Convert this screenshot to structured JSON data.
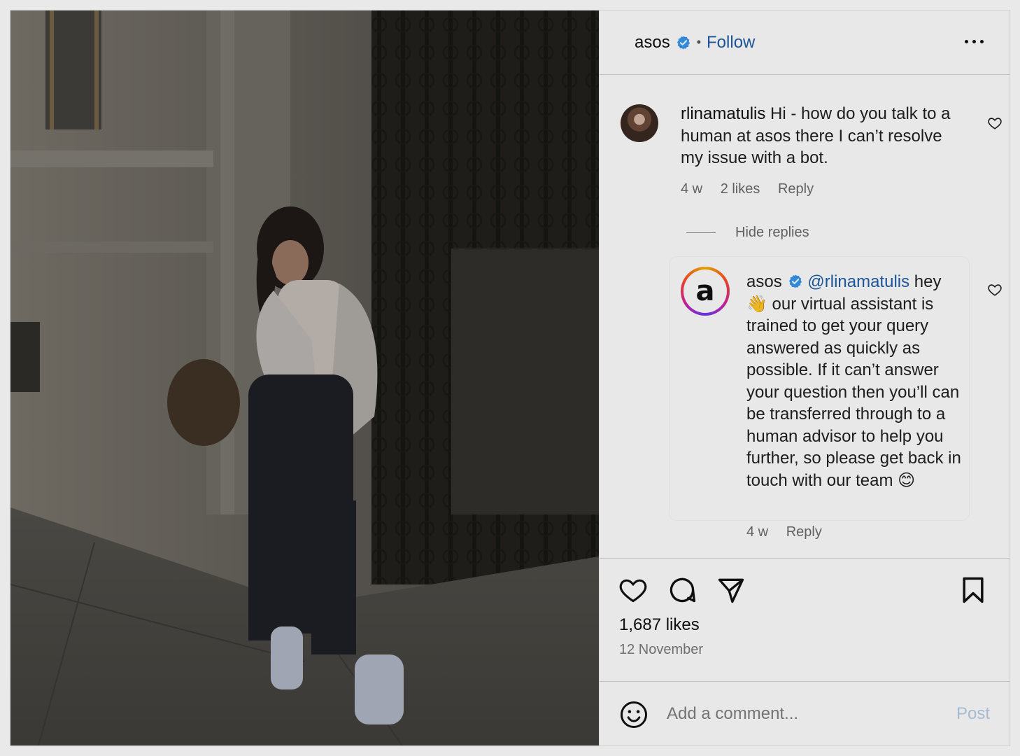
{
  "post": {
    "account": "asos",
    "follow_label": "Follow",
    "separator": "•"
  },
  "comment": {
    "username": "rlinamatulis",
    "text": " Hi - how do you talk to a human at asos there I can’t resolve my issue with a bot.",
    "time": "4 w",
    "likes": "2 likes",
    "reply_label": "Reply"
  },
  "hide_replies_label": "Hide replies",
  "reply": {
    "username": "asos",
    "avatar_letter": "a",
    "mention": "@rlinamatulis",
    "text_1": " hey 👋 our virtual assistant is trained to get your query answered as quickly as possible. If it can’t answer your question then you’ll can be transferred through to a human advisor to help you further, so please get back in touch with our team 😊",
    "time": "4 w",
    "reply_label": "Reply"
  },
  "stats": {
    "likes": "1,687 likes",
    "date": "12 November"
  },
  "compose": {
    "placeholder": "Add a comment...",
    "post_label": "Post"
  },
  "colors": {
    "link_blue": "#1f5fa8",
    "verified_blue": "#3897f0",
    "post_disabled": "#b7cde6"
  },
  "icons": {
    "verified": "verified-badge-icon",
    "more": "more-options-icon",
    "like": "heart-icon",
    "comment": "comment-bubble-icon",
    "share": "paper-plane-icon",
    "save": "bookmark-icon",
    "emoji": "emoji-icon"
  }
}
